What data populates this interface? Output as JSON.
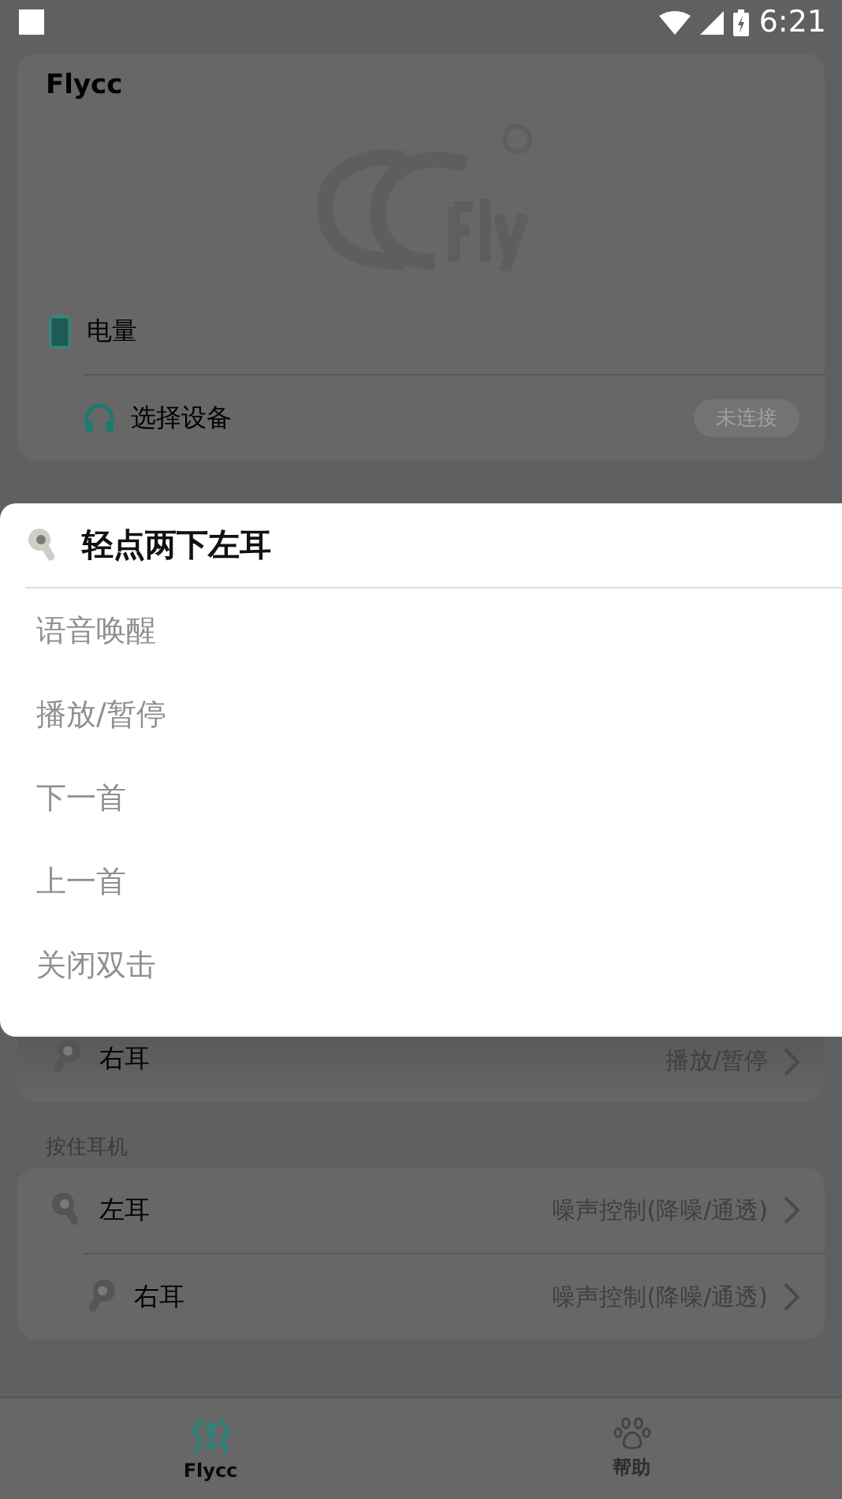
{
  "status_bar": {
    "time": "6:21"
  },
  "device_card": {
    "title": "Flycc",
    "rows": [
      {
        "kind": "battery",
        "label": "电量"
      },
      {
        "kind": "device",
        "label": "选择设备",
        "button": "未连接"
      }
    ]
  },
  "double_tap_section": {
    "rows": [
      {
        "kind": "right",
        "label": "右耳",
        "value": "播放/暂停"
      }
    ]
  },
  "hold_section": {
    "title": "按住耳机",
    "rows": [
      {
        "kind": "left",
        "label": "左耳",
        "value": "噪声控制(降噪/通透)"
      },
      {
        "kind": "right",
        "label": "右耳",
        "value": "噪声控制(降噪/通透)"
      }
    ]
  },
  "dialog": {
    "title": "轻点两下左耳",
    "options": [
      "语音唤醒",
      "播放/暂停",
      "下一首",
      "上一首",
      "关闭双击"
    ]
  },
  "bottom_nav": [
    {
      "kind": "app",
      "label": "Flycc",
      "selected": true
    },
    {
      "kind": "help",
      "label": "帮助",
      "selected": false
    }
  ]
}
